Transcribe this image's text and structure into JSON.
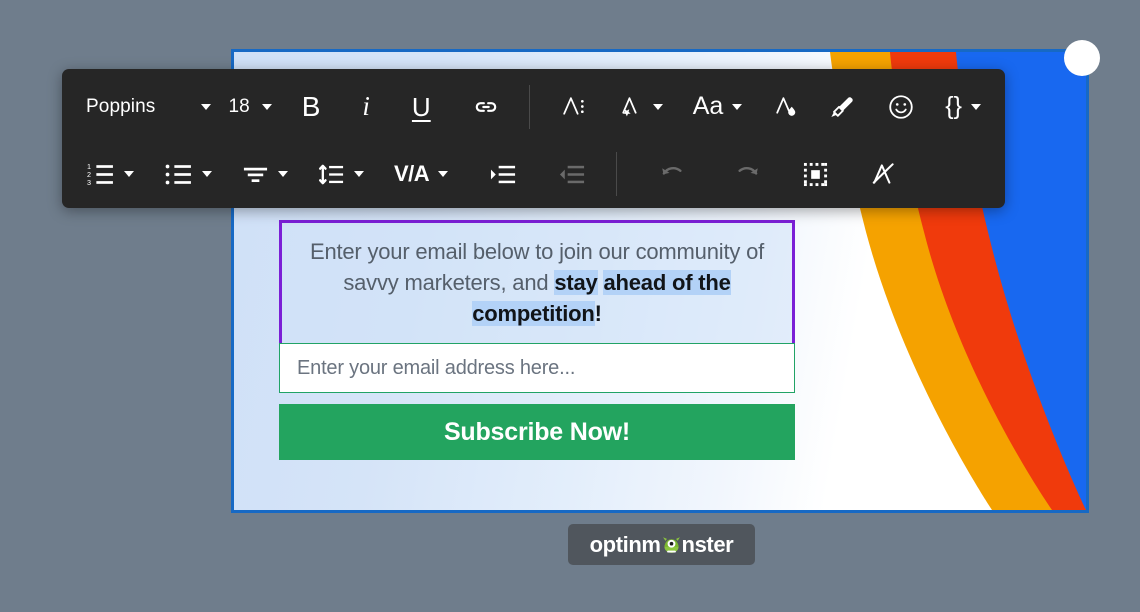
{
  "app": {
    "background_color": "#6f7d8c",
    "brand": "optinmonster",
    "brand_parts": {
      "left": "optinm",
      "right": "nster"
    }
  },
  "toolbar": {
    "background_color": "#262626",
    "row1": [
      {
        "name": "font-family-select",
        "label": "Poppins",
        "type": "dropdown",
        "interactable": true
      },
      {
        "name": "font-size-select",
        "label": "18",
        "type": "dropdown",
        "interactable": true
      },
      {
        "name": "bold-button",
        "label": "B",
        "type": "button",
        "interactable": true
      },
      {
        "name": "italic-button",
        "label": "i",
        "type": "button",
        "interactable": true
      },
      {
        "name": "underline-button",
        "label": "U",
        "type": "button",
        "interactable": true
      },
      {
        "name": "link-button",
        "label": "link-icon",
        "type": "button",
        "interactable": true
      },
      {
        "name": "text-color-button",
        "label": "A:",
        "type": "button",
        "interactable": true
      },
      {
        "name": "text-effects-button",
        "label": "A-star-icon",
        "type": "dropdown",
        "interactable": true
      },
      {
        "name": "text-case-button",
        "label": "Aa",
        "type": "dropdown",
        "interactable": true
      },
      {
        "name": "font-color-button",
        "label": "A-drop-icon",
        "type": "button",
        "interactable": true
      },
      {
        "name": "highlighter-button",
        "label": "highlighter-icon",
        "type": "button",
        "interactable": true
      },
      {
        "name": "emoji-button",
        "label": "emoji-icon",
        "type": "button",
        "interactable": true
      },
      {
        "name": "smart-tags-button",
        "label": "{}",
        "type": "dropdown",
        "interactable": true
      }
    ],
    "row2": [
      {
        "name": "ordered-list-button",
        "label": "numbered-list-icon",
        "type": "dropdown",
        "interactable": true
      },
      {
        "name": "unordered-list-button",
        "label": "bullet-list-icon",
        "type": "dropdown",
        "interactable": true
      },
      {
        "name": "align-button",
        "label": "align-center-icon",
        "type": "dropdown",
        "interactable": true
      },
      {
        "name": "line-height-button",
        "label": "line-height-icon",
        "type": "dropdown",
        "interactable": true
      },
      {
        "name": "letter-spacing-button",
        "label": "V/A",
        "type": "dropdown",
        "interactable": true
      },
      {
        "name": "indent-button",
        "label": "indent-icon",
        "type": "button",
        "interactable": true
      },
      {
        "name": "outdent-button",
        "label": "outdent-icon",
        "type": "button",
        "interactable": false,
        "disabled": true
      },
      {
        "name": "undo-button",
        "label": "undo-icon",
        "type": "button",
        "interactable": false,
        "disabled": true
      },
      {
        "name": "redo-button",
        "label": "redo-icon",
        "type": "button",
        "interactable": false,
        "disabled": true
      },
      {
        "name": "select-all-button",
        "label": "select-region-icon",
        "type": "button",
        "interactable": true
      },
      {
        "name": "clear-formatting-button",
        "label": "clear-format-icon",
        "type": "button",
        "interactable": true
      }
    ]
  },
  "canvas": {
    "border_color": "#1769c4",
    "selection_border_color": "#7b1fd6",
    "selection_highlight_color": "#b3d2f7",
    "text_block": {
      "line1": "Enter your email below to join our",
      "line2_prefix": "community of savvy marketers, and ",
      "selected_a": "stay",
      "selected_b": "ahead of the competition",
      "trailing": "!"
    },
    "email_input": {
      "placeholder": "Enter your email address here...",
      "value": "",
      "border_color": "#21a366"
    },
    "subscribe_button": {
      "label": "Subscribe Now!",
      "background_color": "#23a45f",
      "text_color": "#ffffff"
    },
    "rainbow": {
      "colors": [
        "#f5a200",
        "#f03a0c",
        "#1868f0"
      ]
    }
  }
}
